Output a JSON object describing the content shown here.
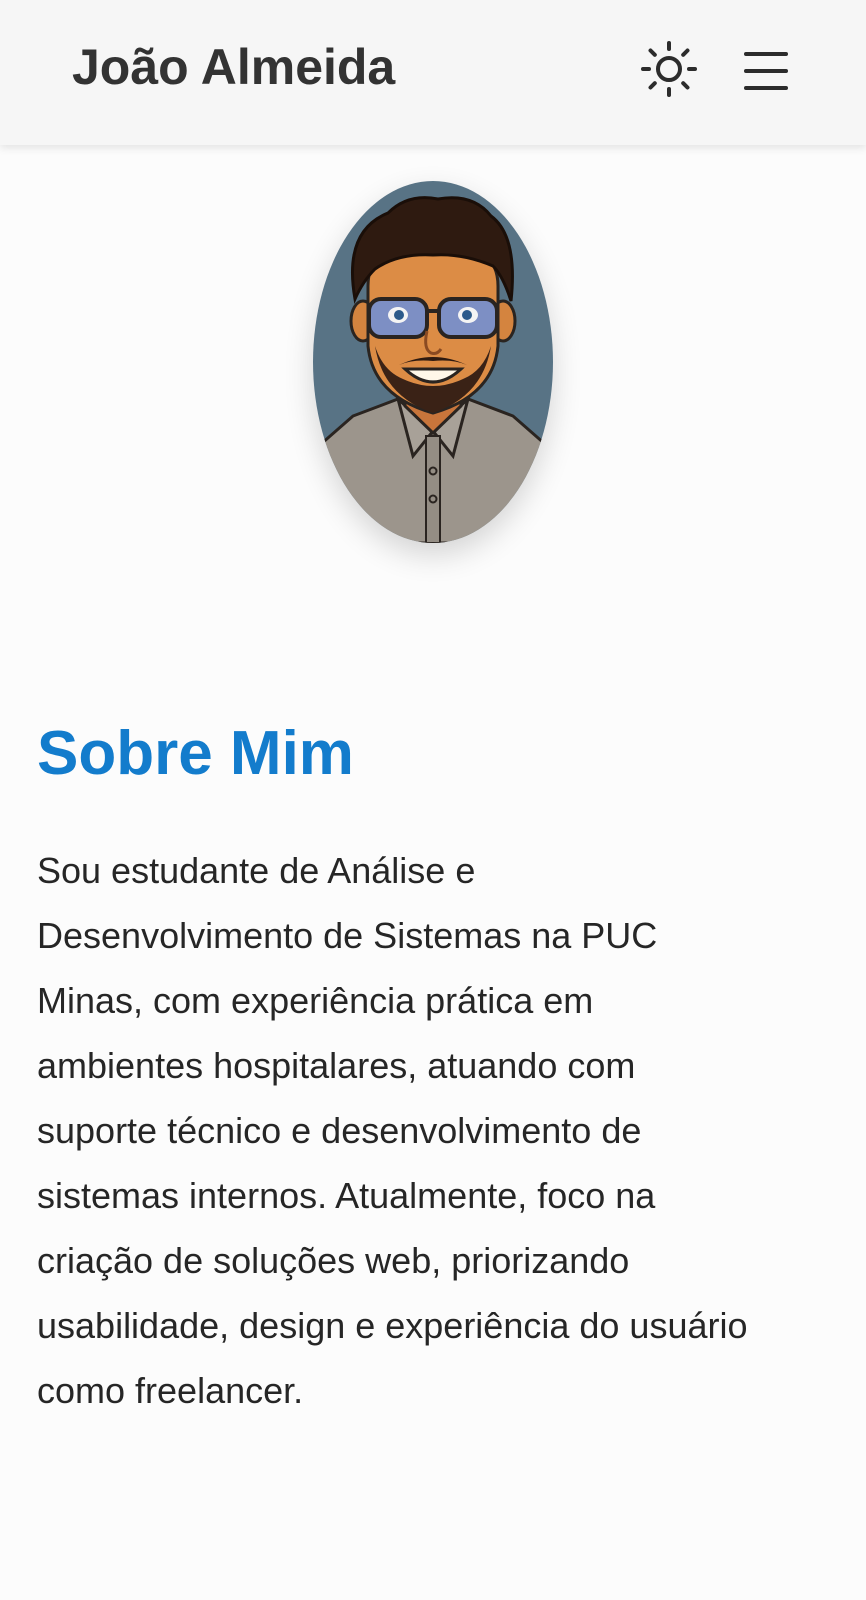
{
  "header": {
    "brand": "João Almeida",
    "theme_toggle_icon": "sun-icon",
    "menu_icon": "hamburger-menu-icon"
  },
  "profile": {
    "avatar_description_icon": "avatar-illustration"
  },
  "about": {
    "title": "Sobre Mim",
    "text": "Sou estudante de Análise e Desenvolvimento de Sistemas na PUC Minas, com experiência prática em ambientes hospitalares, atuando com suporte técnico e desenvolvimento de sistemas internos. Atualmente, foco na criação de soluções web, priorizando usabilidade, design e experiência do usuário como freelancer."
  },
  "colors": {
    "accent": "#137ccc",
    "header_bg": "#f6f6f6",
    "text": "#262626",
    "avatar_bg": "#587385"
  }
}
